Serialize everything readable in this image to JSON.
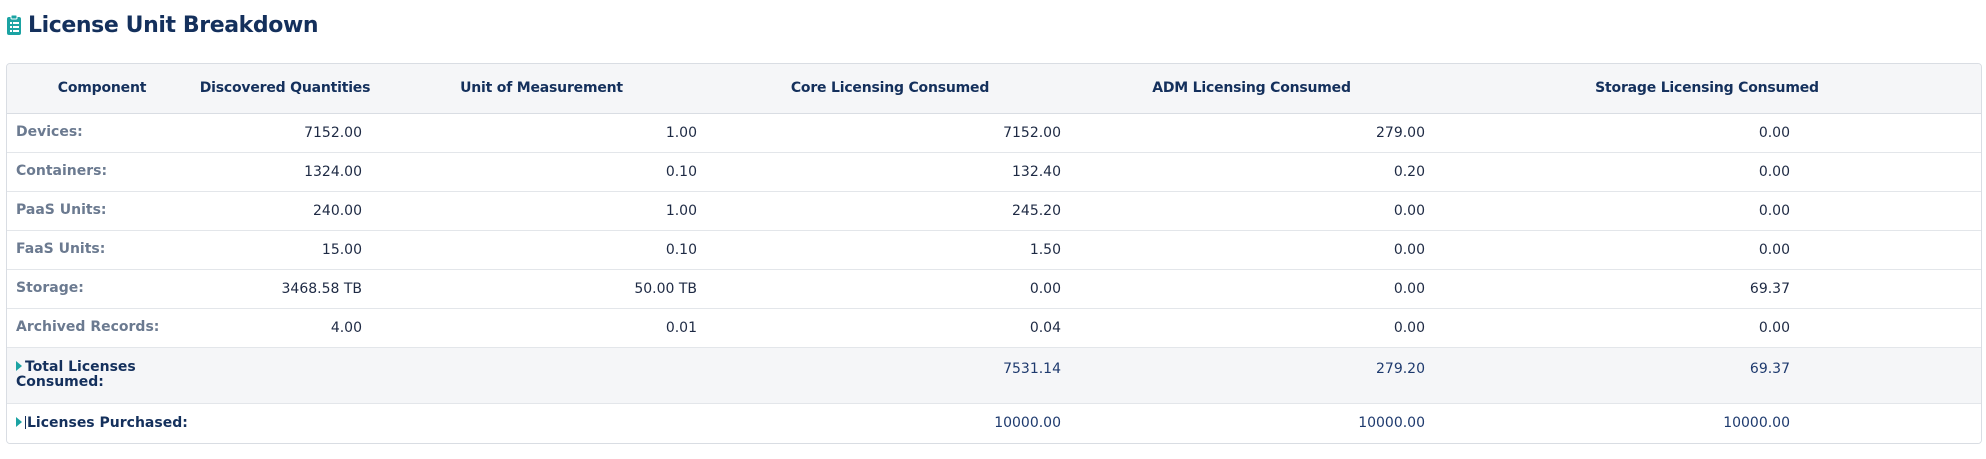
{
  "page": {
    "title": "License Unit Breakdown",
    "icon": "clipboard-list-icon",
    "icon_color": "#1ba3a3",
    "title_color": "#14305c"
  },
  "table": {
    "headers": [
      "Component",
      "Discovered Quantities",
      "Unit of Measurement",
      "Core Licensing Consumed",
      "ADM Licensing Consumed",
      "Storage Licensing Consumed"
    ],
    "rows": [
      {
        "component": "Devices:",
        "discovered": "7152.00",
        "unit": "1.00",
        "core": "7152.00",
        "adm": "279.00",
        "storage": "0.00"
      },
      {
        "component": "Containers:",
        "discovered": "1324.00",
        "unit": "0.10",
        "core": "132.40",
        "adm": "0.20",
        "storage": "0.00"
      },
      {
        "component": "PaaS Units:",
        "discovered": "240.00",
        "unit": "1.00",
        "core": "245.20",
        "adm": "0.00",
        "storage": "0.00"
      },
      {
        "component": "FaaS Units:",
        "discovered": "15.00",
        "unit": "0.10",
        "core": "1.50",
        "adm": "0.00",
        "storage": "0.00"
      },
      {
        "component": "Storage:",
        "discovered": "3468.58 TB",
        "unit": "50.00 TB",
        "core": "0.00",
        "adm": "0.00",
        "storage": "69.37"
      },
      {
        "component": "Archived Records:",
        "discovered": "4.00",
        "unit": "0.01",
        "core": "0.04",
        "adm": "0.00",
        "storage": "0.00"
      }
    ],
    "total": {
      "label_line1": "Total Licenses",
      "label_line2": "Consumed:",
      "core": "7531.14",
      "adm": "279.20",
      "storage": "69.37"
    },
    "purchased": {
      "label": "Licenses Purchased:",
      "core": "10000.00",
      "adm": "10000.00",
      "storage": "10000.00"
    }
  }
}
